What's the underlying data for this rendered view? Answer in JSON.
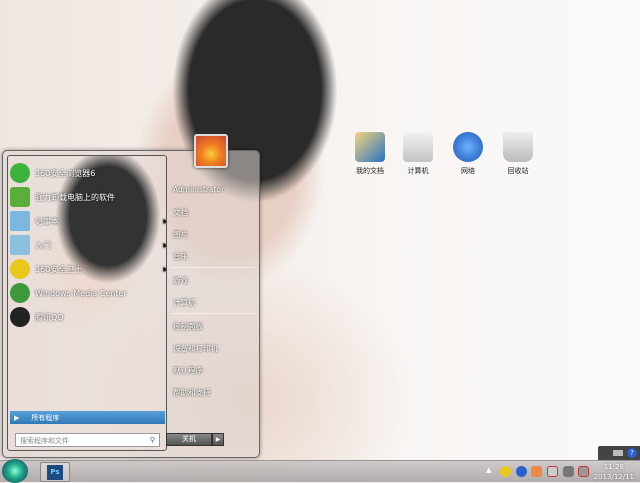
{
  "desktop_icons": [
    {
      "label": "我的文档",
      "color": "#e9c35a"
    },
    {
      "label": "计算机",
      "color": "#d8d8d8"
    },
    {
      "label": "网络",
      "color": "#2a6fd0"
    },
    {
      "label": "回收站",
      "color": "#c8c8c8"
    }
  ],
  "start_menu": {
    "programs": [
      {
        "label": "360安全浏览器6",
        "icon": "360-browser-icon",
        "color": "#3cb43c"
      },
      {
        "label": "强力卸载电脑上的软件",
        "icon": "uninstall-icon",
        "color": "#5aae3a"
      },
      {
        "label": "记事本",
        "icon": "notepad-icon",
        "color": "#7ab8e0",
        "submenu": true
      },
      {
        "label": "入门",
        "icon": "getting-started-icon",
        "color": "#8cc0e0",
        "submenu": true
      },
      {
        "label": "360安全卫士",
        "icon": "360-safe-icon",
        "color": "#e8c81c",
        "submenu": true
      },
      {
        "label": "Windows Media Center",
        "icon": "media-center-icon",
        "color": "#3c9a3c"
      },
      {
        "label": "腾讯QQ",
        "icon": "qq-icon",
        "color": "#222"
      }
    ],
    "all_programs": "所有程序",
    "search_placeholder": "搜索程序和文件",
    "right_items": [
      "Administrator",
      "文档",
      "图片",
      "音乐",
      "游戏",
      "计算机",
      "控制面板",
      "设备和打印机",
      "默认程序",
      "帮助和支持"
    ],
    "shutdown": "关机"
  },
  "taskbar": {
    "ps_label": "Ps",
    "time": "11:28",
    "date": "2013/12/11"
  }
}
